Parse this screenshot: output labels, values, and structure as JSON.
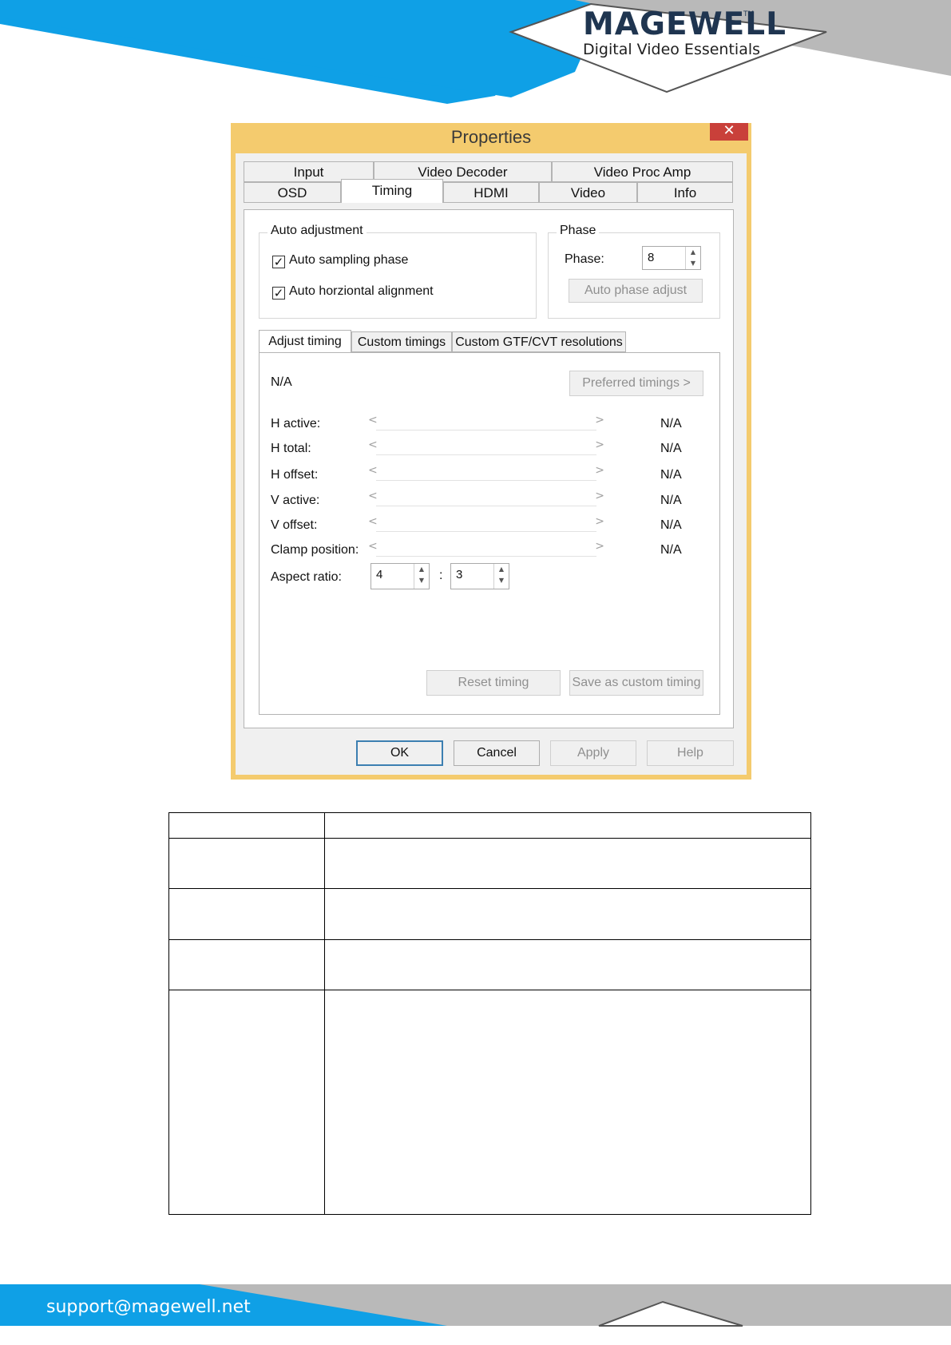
{
  "brand": {
    "logo_text": "MAGEWELL",
    "trademark": "TM",
    "tagline": "Digital Video Essentials",
    "colors": {
      "blue": "#0fa0e6",
      "gray": "#b8b8b8",
      "dark": "#1f3550"
    }
  },
  "dialog": {
    "title": "Properties",
    "close_label": "✕",
    "tabs_row1": [
      "Input",
      "Video Decoder",
      "Video Proc Amp"
    ],
    "tabs_row2": [
      "OSD",
      "Timing",
      "HDMI",
      "Video",
      "Info"
    ],
    "active_tab": "Timing",
    "auto_adjustment": {
      "label": "Auto adjustment",
      "auto_sampling_phase": {
        "label": "Auto sampling phase",
        "checked": true,
        "mark": "✓"
      },
      "auto_horizontal_alignment": {
        "label": "Auto horziontal alignment",
        "checked": true,
        "mark": "✓"
      }
    },
    "phase": {
      "label": "Phase",
      "field_label": "Phase:",
      "value": "8",
      "auto_phase_button": "Auto phase adjust"
    },
    "subtabs": [
      "Adjust timing",
      "Custom timings",
      "Custom GTF/CVT resolutions"
    ],
    "active_subtab": "Adjust timing",
    "adjust": {
      "status": "N/A",
      "preferred_button": "Preferred timings >",
      "rows": [
        {
          "label": "H active:",
          "value": "N/A"
        },
        {
          "label": "H total:",
          "value": "N/A"
        },
        {
          "label": "H offset:",
          "value": "N/A"
        },
        {
          "label": "V active:",
          "value": "N/A"
        },
        {
          "label": "V offset:",
          "value": "N/A"
        },
        {
          "label": "Clamp position:",
          "value": "N/A"
        }
      ],
      "slider_left": "<",
      "slider_right": ">",
      "aspect_label": "Aspect ratio:",
      "aspect_w": "4",
      "aspect_sep": ":",
      "aspect_h": "3",
      "reset_button": "Reset timing",
      "save_button": "Save as custom timing"
    },
    "buttons": {
      "ok": "OK",
      "cancel": "Cancel",
      "apply": "Apply",
      "help": "Help"
    }
  },
  "footer": {
    "email": "support@magewell.net"
  }
}
